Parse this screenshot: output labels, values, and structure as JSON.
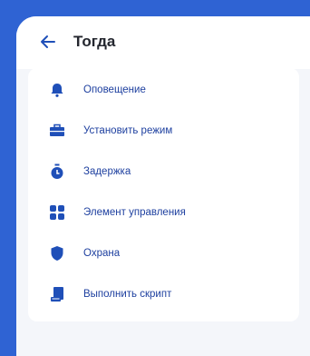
{
  "header": {
    "title": "Тогда"
  },
  "menu": {
    "items": [
      {
        "label": "Оповещение",
        "icon": "bell-icon"
      },
      {
        "label": "Установить режим",
        "icon": "briefcase-icon"
      },
      {
        "label": "Задержка",
        "icon": "timer-icon"
      },
      {
        "label": "Элемент управления",
        "icon": "control-grid-icon"
      },
      {
        "label": "Охрана",
        "icon": "shield-icon"
      },
      {
        "label": "Выполнить скрипт",
        "icon": "script-icon"
      }
    ]
  },
  "colors": {
    "outer_background": "#2f63d3",
    "screen_background": "#f4f6fa",
    "accent": "#1f4fb8",
    "text_primary": "#23262e"
  }
}
